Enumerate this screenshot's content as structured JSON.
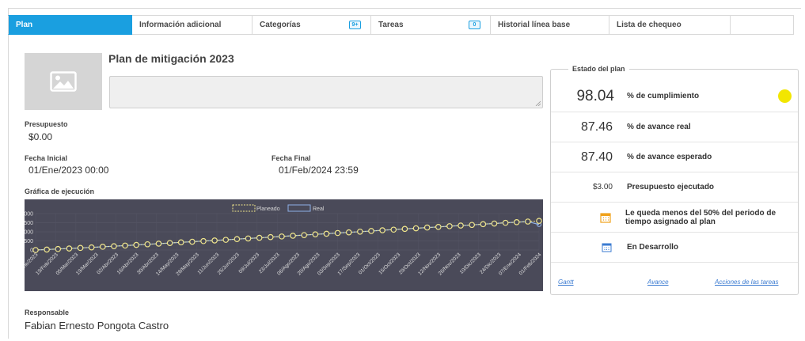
{
  "tabs": [
    {
      "label": "Plan"
    },
    {
      "label": "Información adicional"
    },
    {
      "label": "Categorías",
      "badge": "9+"
    },
    {
      "label": "Tareas",
      "badge": "0"
    },
    {
      "label": "Historial línea base"
    },
    {
      "label": "Lista de chequeo"
    }
  ],
  "plan": {
    "title": "Plan de mitigación 2023",
    "image_icon": "image-placeholder-icon",
    "description": ""
  },
  "fields": {
    "budget_label": "Presupuesto",
    "budget_value": "$0.00",
    "start_label": "Fecha Inicial",
    "start_value": "01/Ene/2023 00:00",
    "end_label": "Fecha Final",
    "end_value": "01/Feb/2024 23:59",
    "chart_label": "Gráfica de ejecución",
    "owner_label": "Responsable",
    "owner_value": "Fabian Ernesto Pongota Castro"
  },
  "status": {
    "legend": "Estado del plan",
    "compliance_value": "98.04",
    "compliance_label": "% de cumplimiento",
    "compliance_color": "#f2e600",
    "real_value": "87.46",
    "real_label": "% de avance real",
    "expected_value": "87.40",
    "expected_label": "% de avance esperado",
    "budget_value": "$3.00",
    "budget_label": "Presupuesto ejecutado",
    "period_msg": "Le queda menos del 50% del periodo de tiempo asignado al plan",
    "period_icon": "calendar-warning-icon",
    "state_label": "En Desarrollo",
    "state_icon": "calendar-icon",
    "links": {
      "gantt": "Gantt",
      "progress": "Avance",
      "actions": "Acciones de las tareas"
    }
  },
  "chart_data": {
    "type": "line",
    "series": [
      {
        "name": "Planeado",
        "color": "#f0e68c",
        "style": "dashed"
      },
      {
        "name": "Real",
        "color": "#8fb0e8",
        "style": "solid"
      }
    ],
    "y_ticks": [
      "2000",
      "1500",
      "1000",
      "500",
      "0"
    ],
    "ylim": [
      0,
      2000
    ],
    "x_labels": [
      "01/Ene/2023",
      "19/Feb/2023",
      "05/Mar/2023",
      "19/Mar/2023",
      "02/Abr/2023",
      "16/Abr/2023",
      "30/Abr/2023",
      "14/May/2023",
      "28/May/2023",
      "11/Jun/2023",
      "25/Jun/2023",
      "09/Jul/2023",
      "23/Jul/2023",
      "06/Ago/2023",
      "20/Ago/2023",
      "03/Sep/2023",
      "17/Sep/2023",
      "01/Oct/2023",
      "15/Oct/2023",
      "29/Oct/2023",
      "12/Nov/2023",
      "26/Nov/2023",
      "10/Dic/2023",
      "24/Dic/2023",
      "07/Ene/2024",
      "01/Feb/2024"
    ],
    "planned": [
      0,
      25,
      55,
      85,
      115,
      145,
      180,
      210,
      245,
      280,
      315,
      350,
      385,
      420,
      455,
      490,
      525,
      560,
      600,
      635,
      670,
      710,
      745,
      785,
      820,
      860,
      895,
      935,
      970,
      1010,
      1045,
      1085,
      1120,
      1160,
      1195,
      1235,
      1270,
      1310,
      1345,
      1380,
      1420,
      1455,
      1495,
      1530,
      1565,
      1600
    ],
    "real": [
      0,
      25,
      55,
      85,
      115,
      145,
      180,
      210,
      245,
      280,
      315,
      350,
      385,
      420,
      455,
      490,
      525,
      560,
      600,
      635,
      670,
      710,
      745,
      785,
      820,
      860,
      895,
      935,
      970,
      1010,
      1045,
      1085,
      1120,
      1160,
      1195,
      1235,
      1270,
      1310,
      1345,
      1380,
      1420,
      1455,
      1495,
      1530,
      1565,
      1400
    ]
  }
}
